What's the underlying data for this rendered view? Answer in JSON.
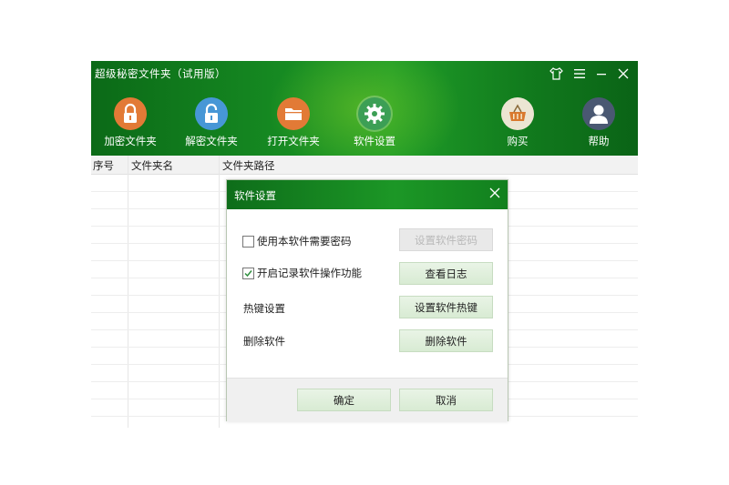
{
  "window": {
    "title": "超级秘密文件夹（试用版）"
  },
  "toolbar": {
    "items": [
      {
        "label": "加密文件夹",
        "icon": "lock-icon",
        "color": "#e07b3a"
      },
      {
        "label": "解密文件夹",
        "icon": "unlock-icon",
        "color": "#4a9ad6"
      },
      {
        "label": "打开文件夹",
        "icon": "folder-icon",
        "color": "#e07b3a"
      },
      {
        "label": "软件设置",
        "icon": "gear-icon",
        "color": "#3fa055"
      },
      {
        "label": "购买",
        "icon": "basket-icon",
        "color": "#ece6d6"
      },
      {
        "label": "帮助",
        "icon": "user-icon",
        "color": "#4b5a73"
      }
    ]
  },
  "table": {
    "columns": [
      "序号",
      "文件夹名",
      "文件夹路径"
    ]
  },
  "dialog": {
    "title": "软件设置",
    "options": [
      {
        "label": "使用本软件需要密码",
        "checked": false,
        "button": "设置软件密码",
        "enabled": false
      },
      {
        "label": "开启记录软件操作功能",
        "checked": true,
        "button": "查看日志",
        "enabled": true
      }
    ],
    "hotkey": {
      "label": "热键设置",
      "button": "设置软件热键"
    },
    "delete": {
      "label": "删除软件",
      "button": "删除软件"
    },
    "ok": "确定",
    "cancel": "取消"
  },
  "colors": {
    "header_green": "#168a22",
    "button_green": "#d8ebd3"
  }
}
